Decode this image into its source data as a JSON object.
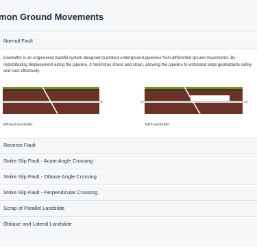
{
  "page": {
    "title": "mon Ground Movements"
  },
  "accordion": {
    "open_item": {
      "label": "Normal Fault",
      "description": "Geobuffer is an engineered backfill system designed to protect underground pipelines from differential ground movements. By redistributing displacement along the pipeline, it minimizes stress and strain, allowing the pipeline to withstand large geohazards safely and cost-effectively.",
      "figures": [
        {
          "caption": "Without Geobuffer"
        },
        {
          "caption": "With Geobuffer"
        }
      ]
    },
    "items": [
      {
        "label": "Reverse Fault"
      },
      {
        "label": "Strike Slip Fault - Acute Angle Crossing"
      },
      {
        "label": "Strike Slip Fault - Obtuse Angle Crossing"
      },
      {
        "label": "Strike Slip Fault - Perpendicular Crossing"
      },
      {
        "label": "Scrap of Parallel Landslide"
      },
      {
        "label": "Oblique and Lateral Landslide"
      }
    ]
  },
  "colors": {
    "grass": "#7a8a2c",
    "soil": "#6b3328",
    "pipe": "#cfd3d6",
    "geobuffer": "#ffffff"
  }
}
